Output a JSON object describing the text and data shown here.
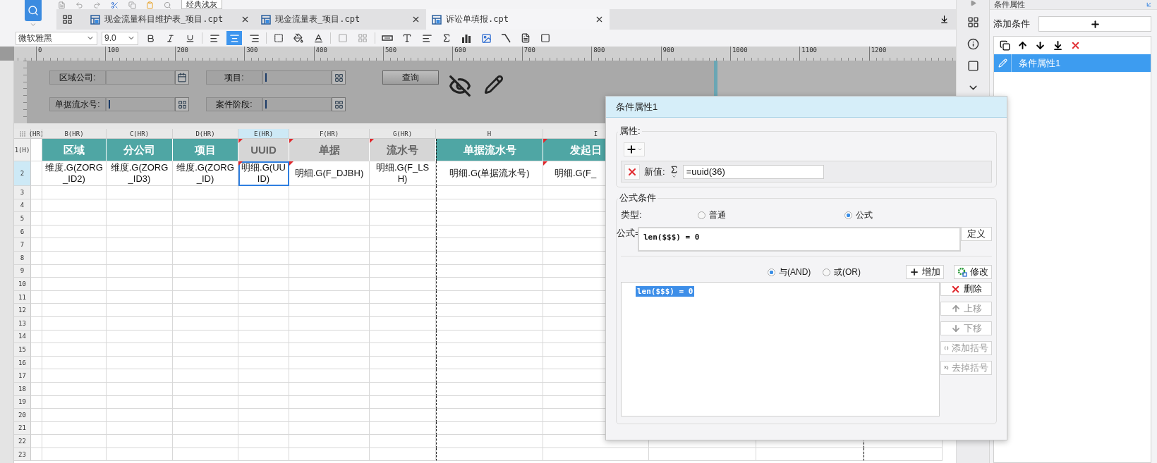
{
  "toolbar": {
    "theme_button": "经典浅灰"
  },
  "tabs": [
    {
      "label": "现金流量科目维护表_项目.cpt",
      "selected": false
    },
    {
      "label": "现金流量表_项目.cpt",
      "selected": false
    },
    {
      "label": "诉讼单填报.cpt",
      "selected": true
    }
  ],
  "format_bar": {
    "font": "微软雅黑",
    "size": "9.0",
    "align_buttons": [
      {
        "selected": false
      },
      {
        "selected": true
      },
      {
        "selected": false
      }
    ]
  },
  "ruler": {
    "marks": [
      "0",
      "100",
      "200",
      "300",
      "400",
      "500",
      "600",
      "700",
      "800",
      "900",
      "1000",
      "1100",
      "1200"
    ]
  },
  "parameters": {
    "fields": [
      {
        "label": "区域公司:",
        "cursor": false
      },
      {
        "label": "项目:",
        "cursor": true
      },
      {
        "label": "单据流水号:",
        "cursor": true
      },
      {
        "label": "案件阶段:",
        "cursor": true
      }
    ],
    "query_button": "查询"
  },
  "sheet": {
    "columns": [
      {
        "label": "(HR)",
        "selected": false
      },
      {
        "label": "B(HR)",
        "selected": false
      },
      {
        "label": "C(HR)",
        "selected": false
      },
      {
        "label": "D(HR)",
        "selected": false
      },
      {
        "label": "E(HR)",
        "selected": true
      },
      {
        "label": "F(HR)",
        "selected": false
      },
      {
        "label": "G(HR)",
        "selected": false
      },
      {
        "label": "H",
        "selected": false
      },
      {
        "label": "I",
        "selected": false
      }
    ],
    "rows": [
      {
        "number": "1(H)",
        "selected": false,
        "cells": [
          {
            "text": "区域",
            "kind": "header",
            "marked": false
          },
          {
            "text": "分公司",
            "kind": "header",
            "marked": false
          },
          {
            "text": "项目",
            "kind": "header",
            "marked": false
          },
          {
            "text": "UUID",
            "kind": "muted",
            "marked": true
          },
          {
            "text": "单据",
            "kind": "muted",
            "marked": true
          },
          {
            "text": "流水号",
            "kind": "muted",
            "marked": true
          },
          {
            "text": "单据流水号",
            "kind": "header",
            "marked": false
          },
          {
            "text": "发起日",
            "kind": "header",
            "marked": true
          }
        ]
      },
      {
        "number": "2",
        "selected": true,
        "cells": [
          {
            "text": "维度.G(ZORG_ID2)",
            "kind": "data",
            "marked": false,
            "selected": false
          },
          {
            "text": "维度.G(ZORG_ID3)",
            "kind": "data",
            "marked": false,
            "selected": false
          },
          {
            "text": "维度.G(ZORG_ID)",
            "kind": "data",
            "marked": false,
            "selected": false
          },
          {
            "text": "明细.G(UUID)",
            "kind": "data",
            "marked": true,
            "selected": true
          },
          {
            "text": "明细.G(F_DJBH)",
            "kind": "data",
            "marked": true,
            "selected": false
          },
          {
            "text": "明细.G(F_LSH)",
            "kind": "data",
            "marked": false,
            "selected": false
          },
          {
            "text": "明细.G(单据流水号)",
            "kind": "data",
            "marked": false,
            "selected": false
          },
          {
            "text": "明细.G(F_",
            "kind": "data",
            "marked": true,
            "selected": false
          }
        ]
      },
      {
        "number": "3",
        "selected": false
      },
      {
        "number": "4",
        "selected": false
      },
      {
        "number": "5",
        "selected": false
      },
      {
        "number": "6",
        "selected": false
      },
      {
        "number": "7",
        "selected": false
      },
      {
        "number": "8",
        "selected": false
      },
      {
        "number": "9",
        "selected": false
      },
      {
        "number": "10",
        "selected": false
      },
      {
        "number": "11",
        "selected": false
      },
      {
        "number": "12",
        "selected": false
      },
      {
        "number": "13",
        "selected": false
      },
      {
        "number": "14",
        "selected": false
      },
      {
        "number": "15",
        "selected": false
      },
      {
        "number": "16",
        "selected": false
      },
      {
        "number": "17",
        "selected": false
      },
      {
        "number": "18",
        "selected": false
      },
      {
        "number": "19",
        "selected": false
      },
      {
        "number": "20",
        "selected": false
      },
      {
        "number": "21",
        "selected": false
      },
      {
        "number": "22",
        "selected": false
      },
      {
        "number": "23",
        "selected": false
      }
    ]
  },
  "dialog": {
    "title": "条件属性1",
    "property_group": {
      "legend": "属性:",
      "new_value_label": "新值:",
      "new_value": "=uuid(36)"
    },
    "formula_group": {
      "legend": "公式条件",
      "type_label": "类型:",
      "types": [
        {
          "label": "普通",
          "selected": false
        },
        {
          "label": "公式",
          "selected": true
        }
      ],
      "formula_label": "公式=",
      "formula": "len($$$) = 0",
      "define_button": "定义",
      "joins": [
        {
          "label": "与(AND)",
          "selected": true
        },
        {
          "label": "或(OR)",
          "selected": false
        }
      ],
      "add_button": "增加",
      "modify_button": "修改",
      "conditions": [
        {
          "text": "len($$$) = 0",
          "selected": true
        }
      ],
      "side_buttons": [
        {
          "label": "删除",
          "kind": "delete",
          "disabled": false
        },
        {
          "label": "上移",
          "kind": "up",
          "disabled": true
        },
        {
          "label": "下移",
          "kind": "down",
          "disabled": true
        },
        {
          "label": "添加括号",
          "kind": "add-brackets",
          "disabled": true
        },
        {
          "label": "去掉括号",
          "kind": "remove-brackets",
          "disabled": true
        }
      ]
    }
  },
  "right_panel": {
    "title": "条件属性",
    "add_label": "添加条件",
    "items": [
      {
        "label": "条件属性1",
        "selected": true
      }
    ]
  }
}
